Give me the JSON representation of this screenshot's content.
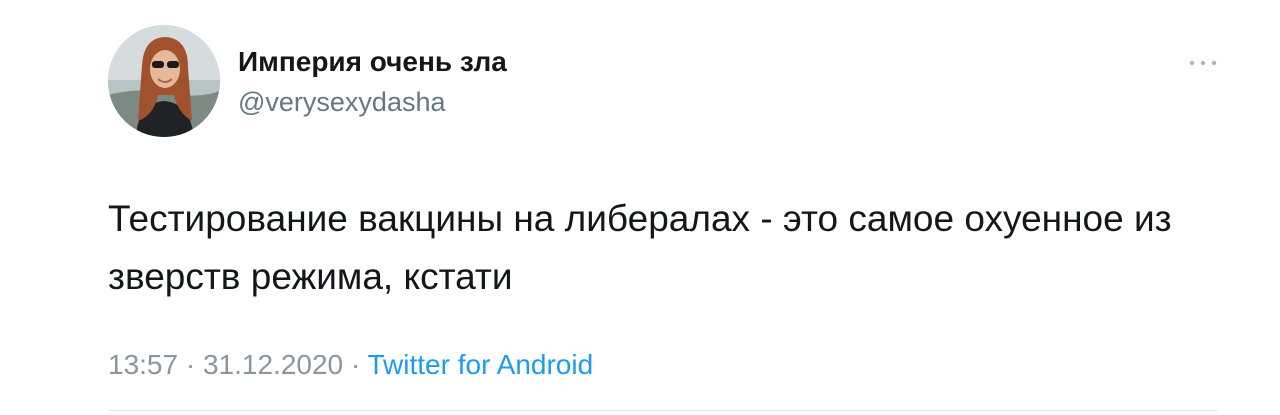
{
  "author": {
    "display_name": "Империя очень зла",
    "handle": "@verysexydasha",
    "avatar_icon": "profile-photo"
  },
  "tweet": {
    "text": "Тестирование вакцины на либералах - это самое охуенное из зверств режима, кстати",
    "time": "13:57",
    "date": "31.12.2020",
    "separator": "·",
    "source": "Twitter for Android"
  },
  "menu": {
    "icon": "more-options-icon"
  },
  "colors": {
    "text": "#14171a",
    "secondary": "#657786",
    "link": "#1d9bf0",
    "divider": "#e1e8ed"
  }
}
